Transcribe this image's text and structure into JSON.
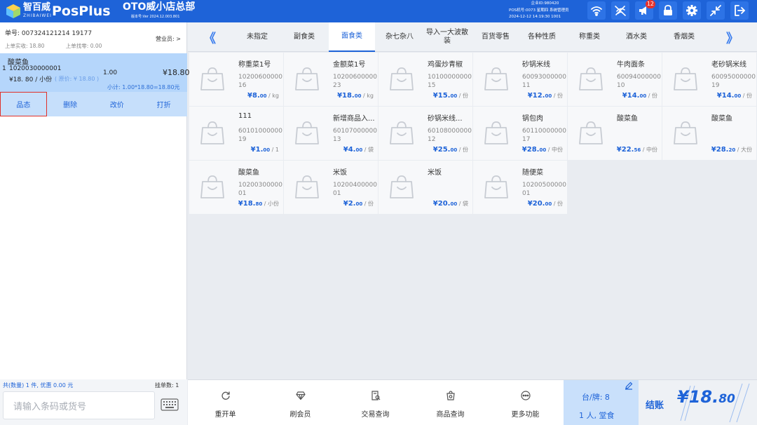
{
  "header": {
    "logo_cn": "智百威",
    "logo_en": "ZHIBAIWEI",
    "app_name": "PosPlus",
    "store_name": "OTO威小店总部",
    "version": "版本号:Ver 2024.12.003.801",
    "enterprise_id": "企业ID:980420",
    "pos_info": "POS机号:0073  星期四  系统管理员",
    "datetime": "2024-12-12 14:19:30   1001",
    "notification_count": "12",
    "icons": [
      "wifi-icon",
      "network-off-icon",
      "broadcast-icon",
      "lock-icon",
      "gear-icon",
      "minimize-icon",
      "logout-icon"
    ]
  },
  "order": {
    "order_no": "单号: 007324121214 19177",
    "cashier_label": "营业员:  >",
    "last_paid": "上单实收: 18.80",
    "last_change": "上单找零: 0.00",
    "item": {
      "name": "酸菜鱼",
      "index": "1",
      "code": "1020030000001",
      "qty": "1.00",
      "total": "¥18.80",
      "price_line": "¥18. 80 / 小份",
      "original_price": "( 原价: ¥ 18.80 )",
      "subtotal": "小计: 1.00*18.80=18.80元"
    },
    "actions": [
      "品态",
      "删除",
      "改价",
      "打折"
    ],
    "summary": "共(数量) 1 件, 优惠 0.00 元",
    "held_orders": "挂单数:  1",
    "barcode_placeholder": "请输入条码或货号"
  },
  "categories": {
    "items": [
      "未指定",
      "副食类",
      "面食类",
      "杂七杂八",
      "导入一大波散装",
      "百货零售",
      "各种性质",
      "称重类",
      "酒水类",
      "香烟类"
    ],
    "selected_index": 2,
    "prev_label": "《",
    "next_label": "》"
  },
  "products": [
    {
      "name": "称重菜1号",
      "code": "1020060000016",
      "price": "¥8.",
      "cents": "00",
      "unit": " / kg"
    },
    {
      "name": "金额菜1号",
      "code": "1020060000023",
      "price": "¥18.",
      "cents": "00",
      "unit": " / kg"
    },
    {
      "name": "鸡蛋炒青椒",
      "code": "1010000000015",
      "price": "¥15.",
      "cents": "00",
      "unit": " / 份"
    },
    {
      "name": "砂锅米线",
      "code": "6009300000011",
      "price": "¥12.",
      "cents": "00",
      "unit": " / 份"
    },
    {
      "name": "牛肉面条",
      "code": "6009400000010",
      "price": "¥14.",
      "cents": "00",
      "unit": " / 份"
    },
    {
      "name": "老砂锅米线",
      "code": "6009500000019",
      "price": "¥14.",
      "cents": "00",
      "unit": " / 份"
    },
    {
      "name": "111",
      "code": "6010100000019",
      "price": "¥1.",
      "cents": "00",
      "unit": " / 1"
    },
    {
      "name": "新增商品入...",
      "code": "6010700000013",
      "price": "¥4.",
      "cents": "00",
      "unit": " / 袋"
    },
    {
      "name": "砂锅米线...",
      "code": "6010800000012",
      "price": "¥25.",
      "cents": "00",
      "unit": " / 份"
    },
    {
      "name": "锅包肉",
      "code": "6011000000017",
      "price": "¥28.",
      "cents": "00",
      "unit": " / 中份"
    },
    {
      "name": "酸菜鱼",
      "code": "",
      "price": "¥22.",
      "cents": "56",
      "unit": " / 中份"
    },
    {
      "name": "酸菜鱼",
      "code": "",
      "price": "¥28.",
      "cents": "20",
      "unit": " / 大份"
    },
    {
      "name": "酸菜鱼",
      "code": "1020030000001",
      "price": "¥18.",
      "cents": "80",
      "unit": " / 小份"
    },
    {
      "name": "米饭",
      "code": "1020040000001",
      "price": "¥2.",
      "cents": "00",
      "unit": " / 份"
    },
    {
      "name": "米饭",
      "code": "",
      "price": "¥20.",
      "cents": "00",
      "unit": " / 袋"
    },
    {
      "name": "随便菜",
      "code": "1020050000001",
      "price": "¥20.",
      "cents": "00",
      "unit": " / 份"
    }
  ],
  "bottom": {
    "buttons": [
      {
        "label": "重开单",
        "icon": "refresh-icon"
      },
      {
        "label": "刷会员",
        "icon": "diamond-icon"
      },
      {
        "label": "交易查询",
        "icon": "receipt-search-icon"
      },
      {
        "label": "商品查询",
        "icon": "product-search-icon"
      },
      {
        "label": "更多功能",
        "icon": "more-icon"
      }
    ],
    "table_label": "台/牌:  8",
    "people_label": "1 人,  堂食",
    "checkout_label": "结账",
    "checkout_amount": "¥18.",
    "checkout_cents": "80"
  },
  "colors": {
    "primary": "#1e63d8",
    "selected_row": "#b5d6fb",
    "action_bar": "#c6dffb",
    "badge": "#e6322c"
  }
}
